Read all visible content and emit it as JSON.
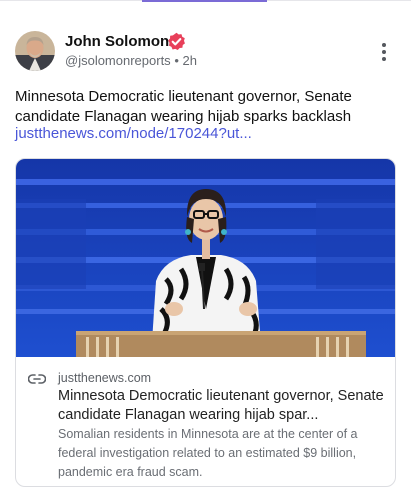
{
  "post": {
    "author_name": "John Solomon",
    "handle": "@jsolomonreports",
    "separator": "•",
    "time": "2h",
    "text": "Minnesota Democratic lieutenant governor, Senate candidate Flanagan wearing hijab sparks backlash",
    "link_text": "justthenews.com/node/170244?ut..."
  },
  "link_card": {
    "domain": "justthenews.com",
    "title": "Minnesota Democratic lieutenant governor, Senate candidate Flanagan wearing hijab spar...",
    "description": "Somalian residents in Minnesota are at the center of a federal investigation related to an estimated $9 billion, pandemic era fraud scam."
  },
  "icons": {
    "verified": "verified-badge-icon",
    "more": "more-vertical-icon",
    "link": "link-icon"
  },
  "colors": {
    "accent": "#7b6bd6",
    "link": "#4a56d8",
    "verified": "#e8405a",
    "stage_blue": "#1b3fb8"
  }
}
